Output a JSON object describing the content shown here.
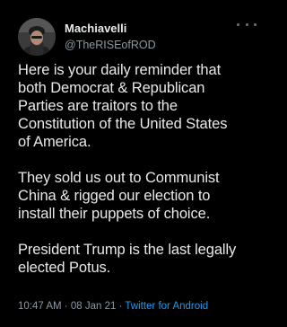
{
  "tweet": {
    "display_name": "Machiavelli",
    "handle": "@TheRISEofROD",
    "paragraphs": [
      "Here is your daily reminder that\nboth Democrat & Republican\nParties are traitors to the\nConstitution of the United States\nof America.",
      "They sold us out to Communist\nChina & rigged our election to\ninstall their puppets of choice.",
      "President Trump is the last legally\nelected Potus."
    ],
    "time": "10:47 AM",
    "separator": "·",
    "date": "08 Jan 21",
    "source": "Twitter for Android"
  },
  "icons": {
    "avatar": "avatar-image",
    "more": "more-options-icon"
  },
  "colors": {
    "background": "#000000",
    "text": "#e7e9ea",
    "secondary": "#8b98a5",
    "link": "#1d9bf0"
  }
}
